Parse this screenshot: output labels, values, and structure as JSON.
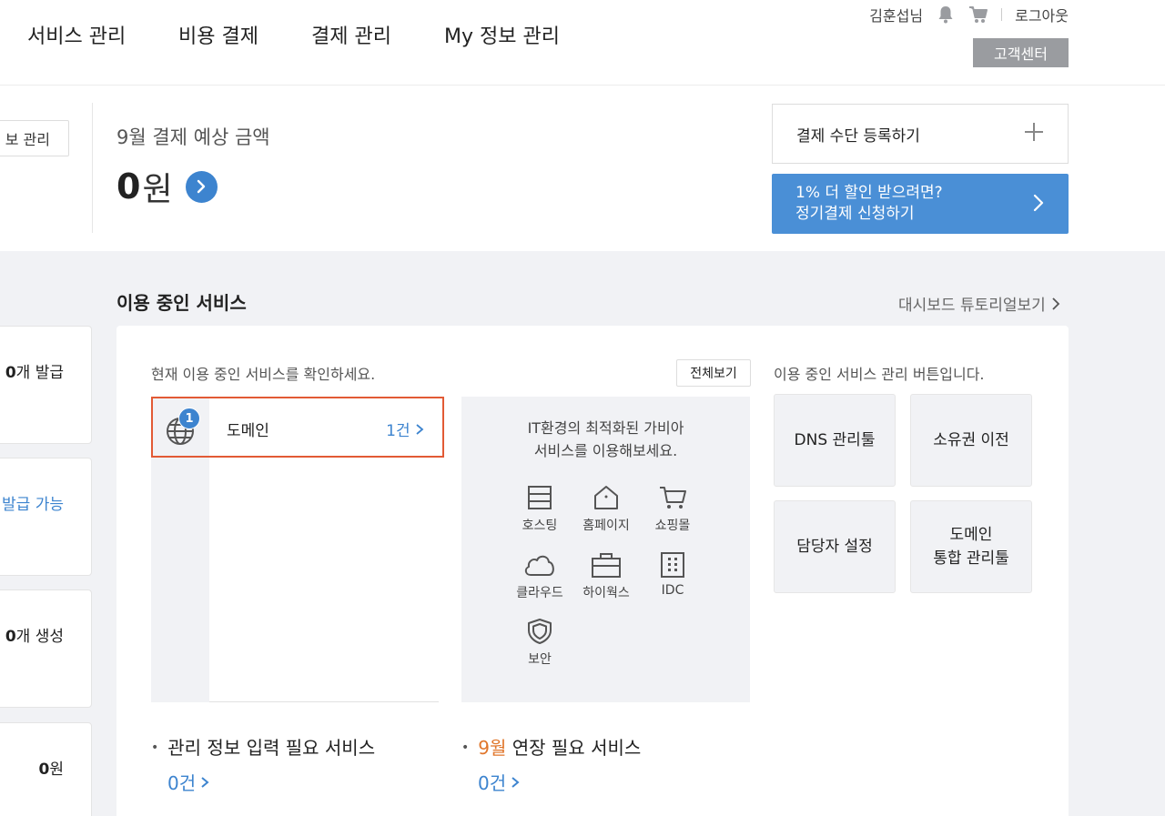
{
  "header": {
    "nav": [
      "서비스 관리",
      "비용 결제",
      "결제 관리",
      "My 정보 관리"
    ],
    "user_name": "김훈섭",
    "user_suffix": "님",
    "logout": "로그아웃",
    "customer_center": "고객센터"
  },
  "summary": {
    "left_button": "보 관리",
    "estimate_title": "9월 결제 예상 금액",
    "estimate_amount": "0",
    "estimate_unit": "원",
    "payment_register": "결제 수단 등록하기",
    "discount_line1": "1% 더 할인 받으려면?",
    "discount_line2": "정기결제 신청하기"
  },
  "side_cards": [
    {
      "bold": "0",
      "text": "개 발급"
    },
    {
      "bold": "",
      "text": "발급 가능"
    },
    {
      "bold": "0",
      "text": "개 생성"
    },
    {
      "bold": "0",
      "text": "원"
    }
  ],
  "services": {
    "title": "이용 중인 서비스",
    "tutorial": "대시보드 튜토리얼보기",
    "desc": "현재 이용 중인 서비스를 확인하세요.",
    "view_all": "전체보기",
    "items": [
      {
        "name": "도메인",
        "count": "1건",
        "badge": "1",
        "icon": "globe-icon"
      }
    ],
    "promo_line1": "IT환경의 최적화된 가비아",
    "promo_line2": "서비스를 이용해보세요.",
    "promo_items": [
      {
        "label": "호스팅",
        "icon": "hosting-icon"
      },
      {
        "label": "홈페이지",
        "icon": "home-icon"
      },
      {
        "label": "쇼핑몰",
        "icon": "cart-icon"
      },
      {
        "label": "클라우드",
        "icon": "cloud-icon"
      },
      {
        "label": "하이웍스",
        "icon": "briefcase-icon"
      },
      {
        "label": "IDC",
        "icon": "building-icon"
      },
      {
        "label": "보안",
        "icon": "shield-icon"
      }
    ],
    "manage_desc": "이용 중인 서비스 관리 버튼입니다.",
    "manage_buttons": [
      {
        "line1": "DNS 관리툴",
        "line2": ""
      },
      {
        "line1": "소유권 이전",
        "line2": ""
      },
      {
        "line1": "담당자 설정",
        "line2": ""
      },
      {
        "line1": "도메인",
        "line2": "통합 관리툴"
      }
    ],
    "needs_info_label": "관리 정보 입력 필요 서비스",
    "needs_info_count": "0건",
    "renewal_month": "9월",
    "renewal_label": " 연장 필요 서비스",
    "renewal_count": "0건"
  }
}
